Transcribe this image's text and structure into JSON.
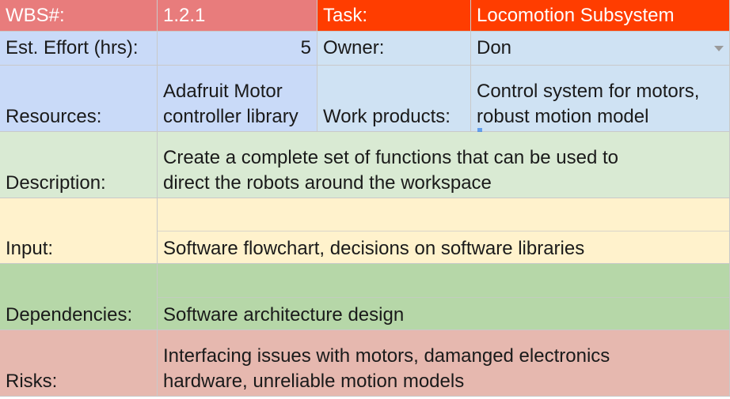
{
  "row1": {
    "wbs_label": "WBS#:",
    "wbs_value": "1.2.1",
    "task_label": "Task:",
    "task_value": "Locomotion Subsystem"
  },
  "row2": {
    "effort_label": "Est. Effort (hrs):",
    "effort_value": "5",
    "owner_label": "Owner:",
    "owner_value": "Don"
  },
  "row3": {
    "resources_label": "Resources:",
    "resources_value": "Adafruit Motor\ncontroller library",
    "work_products_label": "Work products:",
    "work_products_value": "Control system for motors,\nrobust motion model"
  },
  "row4": {
    "label": "Description:",
    "value": "Create a complete set of functions that can be used to\ndirect the robots around the workspace"
  },
  "row5": {
    "label": "Input:",
    "value": "Software flowchart, decisions on software libraries"
  },
  "row6": {
    "label": "Dependencies:",
    "value": "Software architecture design"
  },
  "row7": {
    "label": "Risks:",
    "value": "Interfacing issues with motors, damanged electronics\nhardware, unreliable motion models"
  },
  "colors": {
    "header_pink": "#e87c7c",
    "header_red": "#ff3d00",
    "blue": "#c9daf8",
    "light_blue": "#cfe2f3",
    "mint": "#d9ead3",
    "cream": "#fff2cc",
    "green": "#b6d7a8",
    "rose": "#e6b8af"
  },
  "icons": {
    "owner_dropdown": "chevron-down-icon"
  }
}
